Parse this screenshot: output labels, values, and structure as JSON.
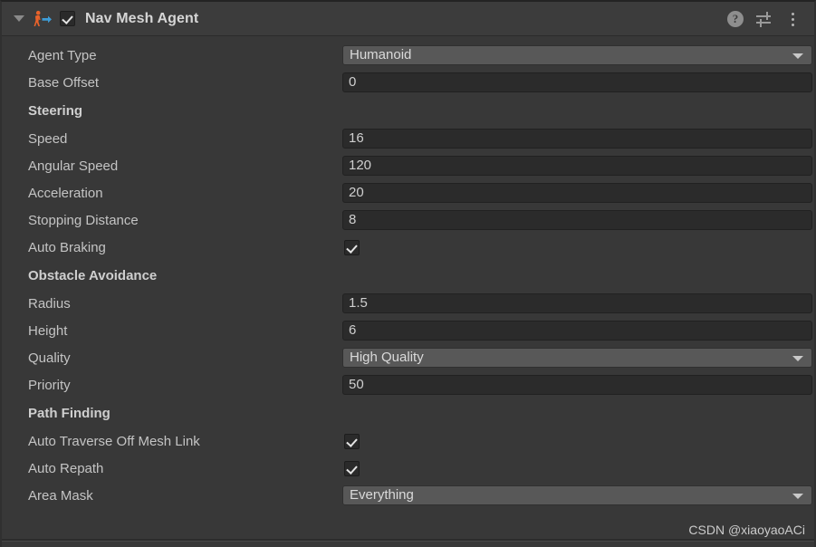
{
  "component": {
    "title": "Nav Mesh Agent",
    "enabled": true,
    "foldout_expanded": true,
    "icon": "nav-mesh-agent-icon",
    "tools": [
      {
        "name": "help-icon",
        "glyph": "?"
      },
      {
        "name": "preset-icon",
        "glyph": "sliders"
      },
      {
        "name": "more-menu-icon",
        "glyph": "kebab"
      }
    ]
  },
  "colors": {
    "panel_background": "#383838",
    "header_background": "#3c3c3c",
    "field_background": "#2b2b2b",
    "popup_background": "#585858",
    "label_text": "#c4c4c4",
    "title_text": "#d6d6d6",
    "icon_orange": "#e8622a",
    "icon_blue": "#3d9bd6"
  },
  "rows": [
    {
      "name": "agent-type",
      "label": "Agent Type",
      "type": "popup",
      "value": "Humanoid"
    },
    {
      "name": "base-offset",
      "label": "Base Offset",
      "type": "text",
      "value": "0"
    },
    {
      "name": "steering",
      "label": "Steering",
      "type": "section"
    },
    {
      "name": "speed",
      "label": "Speed",
      "type": "text",
      "value": "16"
    },
    {
      "name": "angular-speed",
      "label": "Angular Speed",
      "type": "text",
      "value": "120"
    },
    {
      "name": "acceleration",
      "label": "Acceleration",
      "type": "text",
      "value": "20"
    },
    {
      "name": "stopping-distance",
      "label": "Stopping Distance",
      "type": "text",
      "value": "8"
    },
    {
      "name": "auto-braking",
      "label": "Auto Braking",
      "type": "checkbox",
      "value": true
    },
    {
      "name": "obstacle-avoidance",
      "label": "Obstacle Avoidance",
      "type": "section"
    },
    {
      "name": "radius",
      "label": "Radius",
      "type": "text",
      "value": "1.5"
    },
    {
      "name": "height",
      "label": "Height",
      "type": "text",
      "value": "6"
    },
    {
      "name": "quality",
      "label": "Quality",
      "type": "popup",
      "value": "High Quality"
    },
    {
      "name": "priority",
      "label": "Priority",
      "type": "text",
      "value": "50"
    },
    {
      "name": "path-finding",
      "label": "Path Finding",
      "type": "section"
    },
    {
      "name": "auto-traverse-off-mesh-link",
      "label": "Auto Traverse Off Mesh Link",
      "type": "checkbox",
      "value": true
    },
    {
      "name": "auto-repath",
      "label": "Auto Repath",
      "type": "checkbox",
      "value": true
    },
    {
      "name": "area-mask",
      "label": "Area Mask",
      "type": "popup",
      "value": "Everything"
    }
  ],
  "watermark": "CSDN @xiaoyaoACi"
}
